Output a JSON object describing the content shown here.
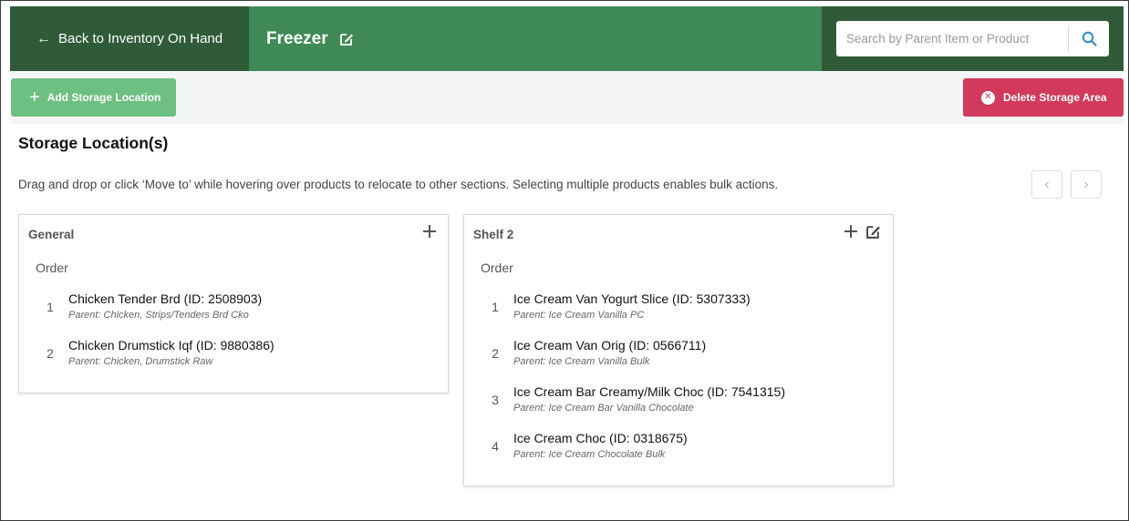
{
  "header": {
    "back_label": "Back to Inventory On Hand",
    "title": "Freezer",
    "search_placeholder": "Search by Parent Item or Product"
  },
  "toolbar": {
    "add_label": "Add Storage Location",
    "delete_label": "Delete Storage Area"
  },
  "section": {
    "title": "Storage Location(s)",
    "instructions": "Drag and drop or click ‘Move to’ while hovering over products to relocate to other sections. Selecting multiple products enables bulk actions."
  },
  "locations": [
    {
      "name": "General",
      "order_label": "Order",
      "items": [
        {
          "num": "1",
          "name": "Chicken Tender Brd (ID: 2508903)",
          "parent": "Parent: Chicken, Strips/Tenders Brd Cko"
        },
        {
          "num": "2",
          "name": "Chicken Drumstick Iqf (ID: 9880386)",
          "parent": "Parent: Chicken, Drumstick Raw"
        }
      ]
    },
    {
      "name": "Shelf 2",
      "order_label": "Order",
      "items": [
        {
          "num": "1",
          "name": "Ice Cream Van Yogurt Slice (ID: 5307333)",
          "parent": "Parent: Ice Cream Vanilla PC"
        },
        {
          "num": "2",
          "name": "Ice Cream Van Orig (ID: 0566711)",
          "parent": "Parent: Ice Cream Vanilla Bulk"
        },
        {
          "num": "3",
          "name": "Ice Cream Bar Creamy/Milk Choc (ID: 7541315)",
          "parent": "Parent: Ice Cream Bar Vanilla Chocolate"
        },
        {
          "num": "4",
          "name": "Ice Cream Choc (ID: 0318675)",
          "parent": "Parent: Ice Cream Chocolate Bulk"
        }
      ]
    }
  ],
  "icons": {
    "back": "arrow-left-icon",
    "edit": "edit-icon",
    "search": "search-icon",
    "add": "plus-icon",
    "delete": "close-circle-icon",
    "prev": "chevron-left-icon",
    "next": "chevron-right-icon"
  },
  "colors": {
    "header_green": "#3f8a57",
    "header_dark": "#2f5b39",
    "add_green": "#6dc082",
    "delete_red": "#d13a5a",
    "search_blue": "#2d8bc9"
  }
}
